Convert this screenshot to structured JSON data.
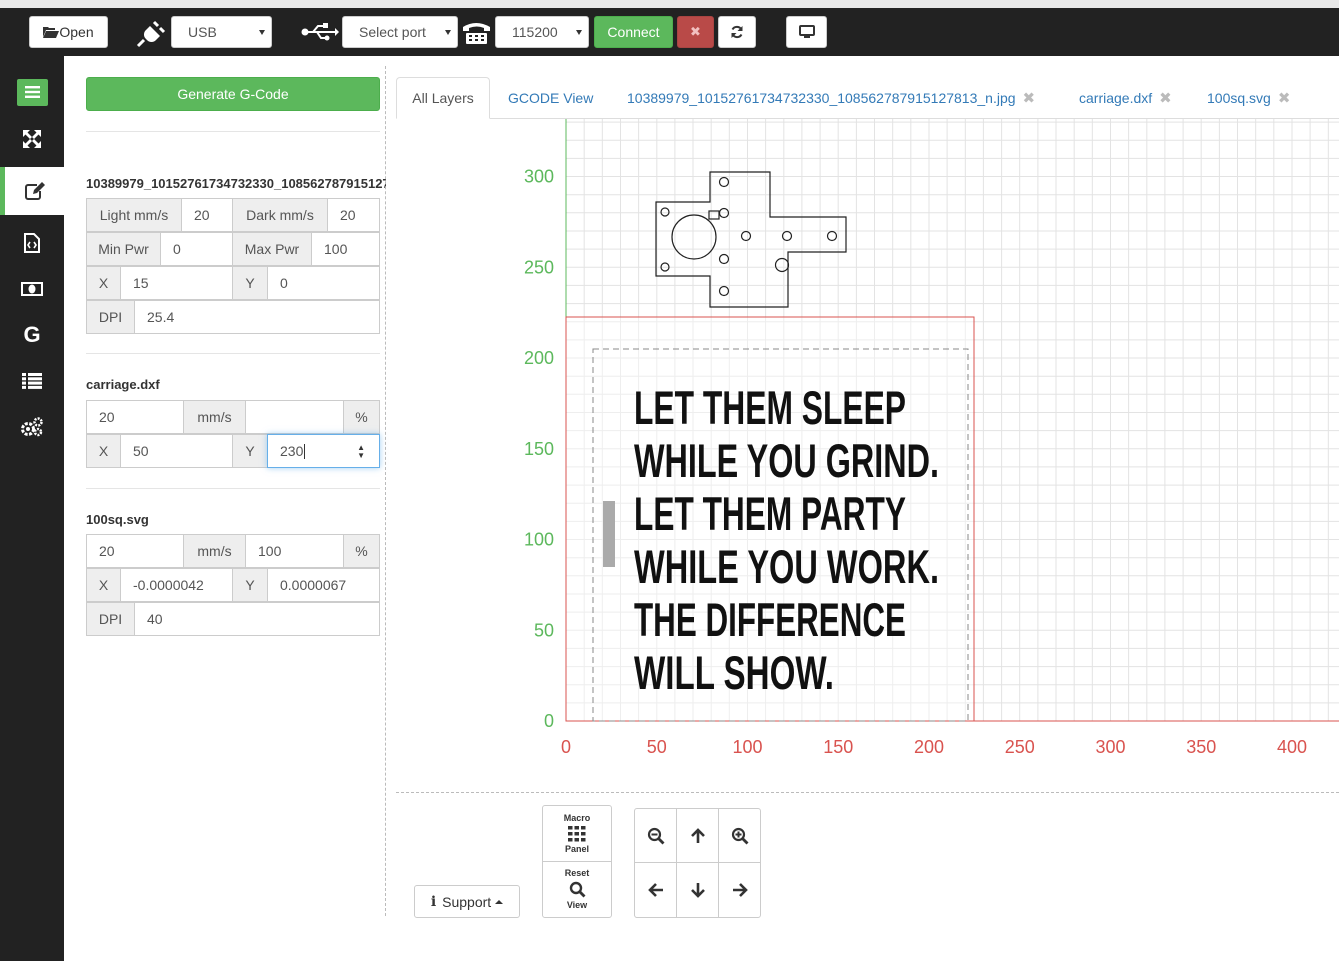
{
  "toolbar": {
    "open_label": "Open",
    "connection_type": "USB",
    "port_placeholder": "Select port",
    "baud_rate": "115200",
    "connect_label": "Connect"
  },
  "sidebar": {
    "items": [
      {
        "icon": "menu-icon"
      },
      {
        "icon": "expand-icon"
      },
      {
        "icon": "edit-icon",
        "active": true
      },
      {
        "icon": "code-file-icon"
      },
      {
        "icon": "money-icon"
      },
      {
        "icon": "g-icon"
      },
      {
        "icon": "list-icon"
      },
      {
        "icon": "gears-icon"
      }
    ]
  },
  "left_panel": {
    "generate_label": "Generate G-Code",
    "jpg_layer": {
      "name": "10389979_10152761734732330_108562787915127813_n.jpg",
      "light_label": "Light mm/s",
      "light_value": "20",
      "dark_label": "Dark mm/s",
      "dark_value": "20",
      "minpwr_label": "Min Pwr",
      "minpwr_value": "0",
      "maxpwr_label": "Max Pwr",
      "maxpwr_value": "100",
      "x_label": "X",
      "x_value": "15",
      "y_label": "Y",
      "y_value": "0",
      "dpi_label": "DPI",
      "dpi_value": "25.4"
    },
    "dxf_layer": {
      "name": "carriage.dxf",
      "speed_value": "20",
      "speed_unit": "mm/s",
      "power_value": "",
      "power_unit": "%",
      "x_label": "X",
      "x_value": "50",
      "y_label": "Y",
      "y_value": "230"
    },
    "svg_layer": {
      "name": "100sq.svg",
      "speed_value": "20",
      "speed_unit": "mm/s",
      "power_value": "100",
      "power_unit": "%",
      "x_label": "X",
      "x_value": "-0.0000042",
      "y_label": "Y",
      "y_value": "0.0000067",
      "dpi_label": "DPI",
      "dpi_value": "40"
    }
  },
  "tabs": {
    "all_layers": "All Layers",
    "gcode_view": "GCODE View",
    "jpg": "10389979_10152761734732330_108562787915127813_n.jpg",
    "dxf": "carriage.dxf",
    "svg": "100sq.svg",
    "close_glyph": "✖"
  },
  "canvas": {
    "x_ticks": [
      "0",
      "50",
      "100",
      "150",
      "200",
      "250",
      "300",
      "350",
      "400"
    ],
    "y_ticks": [
      "0",
      "50",
      "100",
      "150",
      "200",
      "250",
      "300"
    ],
    "axis_x_color": "#d9534f",
    "axis_y_color": "#5cb85c",
    "quote_lines": [
      "LET THEM SLEEP",
      "WHILE YOU GRIND.",
      "LET THEM PARTY",
      "WHILE YOU WORK.",
      "THE DIFFERENCE",
      "WILL SHOW."
    ]
  },
  "controls": {
    "macro_top": "Macro",
    "macro_bottom": "Panel",
    "reset_top": "Reset",
    "reset_bottom": "View",
    "support_label": "Support"
  },
  "colors": {
    "accent_green": "#5cb85c",
    "danger_red": "#b94a48",
    "link_blue": "#337ab7",
    "topbar_bg": "#222222"
  }
}
